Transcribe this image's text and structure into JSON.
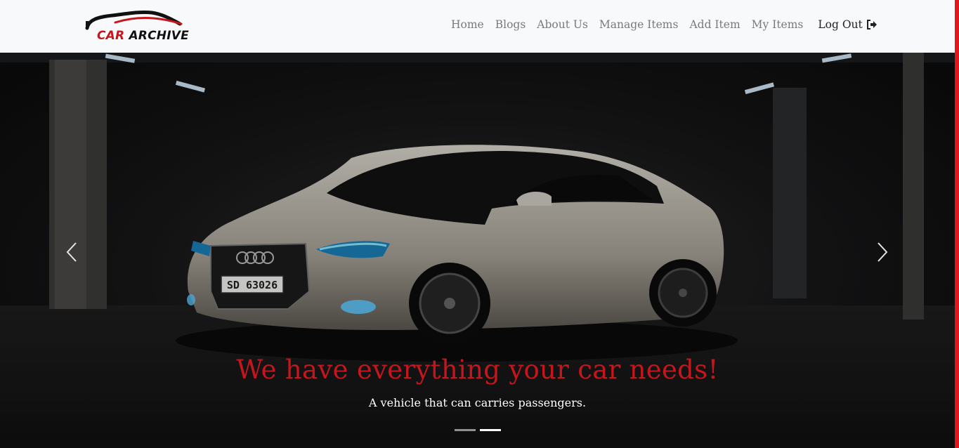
{
  "brand": {
    "word1": "CAR",
    "word2": "ARCHIVE",
    "icon": "car-silhouette-logo"
  },
  "nav": {
    "links": [
      "Home",
      "Blogs",
      "About Us",
      "Manage Items",
      "Add Item",
      "My Items"
    ],
    "logout_label": "Log Out",
    "logout_icon": "sign-out-icon"
  },
  "carousel": {
    "title": "We have everything your car needs!",
    "subtitle": "A vehicle that can carries passengers.",
    "plate": "SD 63026",
    "prev_icon": "chevron-left-icon",
    "next_icon": "chevron-right-icon",
    "slide_count": 2,
    "active_slide": 2
  },
  "colors": {
    "accent": "#c4161c",
    "side_bar": "#e4161c",
    "navbar_bg": "#f8f9fa"
  }
}
